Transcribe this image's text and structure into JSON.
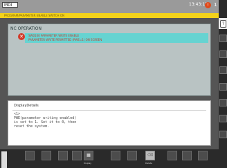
{
  "topbar": {
    "mode": "MDI",
    "clock": "13:43:11",
    "alarm_badge": "!",
    "alarm_count": "1",
    "message": "PROGRAM/PARAMETER ENABLE SWITCH ON"
  },
  "nc_panel": {
    "title": "NC OPERATION",
    "alarm_icon": "error-icon",
    "alarm_line1": "SW0100 PARAMETER WRITE ENABLE",
    "alarm_line2": "PARAMETER WRITE PERMITTED (PWE=1) ON SCREEN"
  },
  "details": {
    "title": "DisplayDetails",
    "body": "<1>\nPWE(parameter writing enabled)\nis set to 1. Set it to 0, then\nreset the system."
  },
  "softkeys": {
    "display_label": "Display",
    "delete_label": "Delete"
  },
  "right_strip": {
    "help_glyph": "?"
  },
  "colors": {
    "topbar": "#9a9a9a",
    "message_bar": "#f3d21a",
    "panel": "#b9c3c3",
    "alarm_highlight": "#66d3d1",
    "alarm_red": "#d13b2a"
  }
}
